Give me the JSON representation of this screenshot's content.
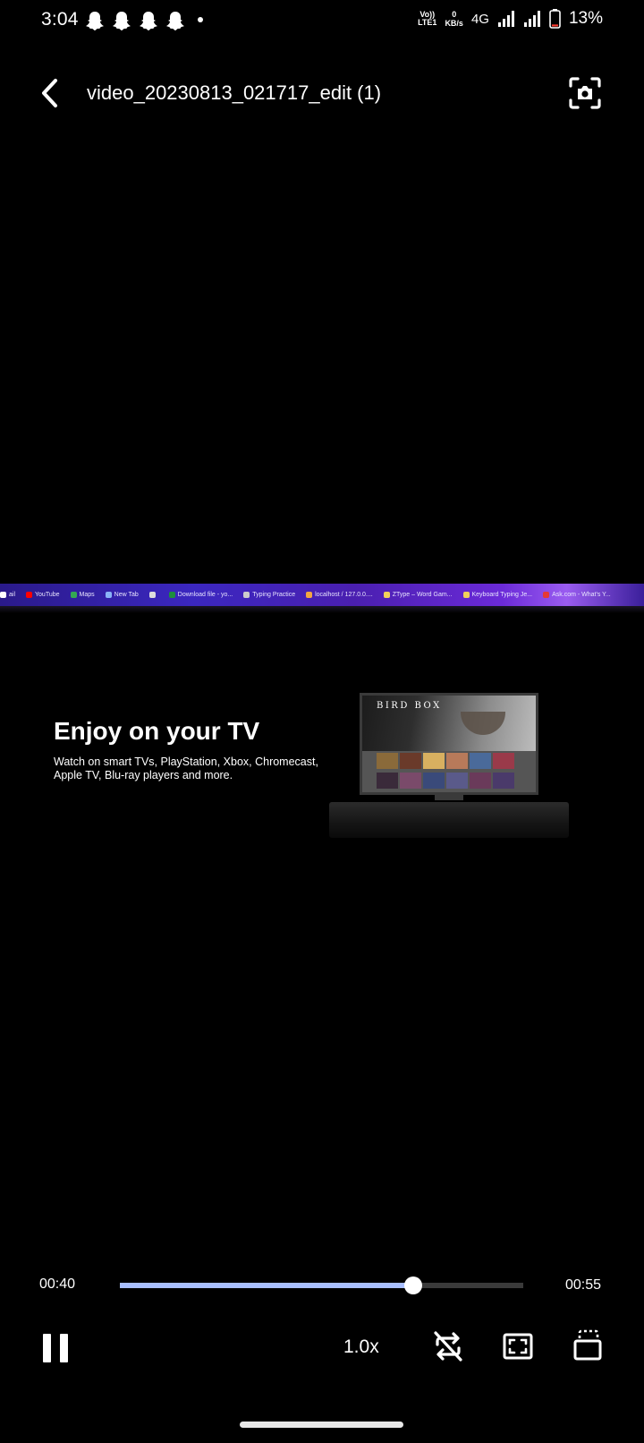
{
  "status_bar": {
    "time": "3:04",
    "notification_icons": [
      "snapchat-icon",
      "snapchat-icon",
      "snapchat-icon",
      "snapchat-icon"
    ],
    "volte_top": "Vo))",
    "volte_bottom": "LTE1",
    "net_speed_value": "0",
    "net_speed_unit": "KB/s",
    "network_type": "4G",
    "battery_percent": "13%",
    "battery_level": 0.13
  },
  "header": {
    "title": "video_20230813_021717_edit (1)"
  },
  "video": {
    "bookmarks": [
      {
        "label": "ail",
        "color": "#ffffff"
      },
      {
        "label": "YouTube",
        "color": "#ff0000"
      },
      {
        "label": "Maps",
        "color": "#34a853"
      },
      {
        "label": "New Tab",
        "color": "#8ab4f8"
      },
      {
        "label": "",
        "color": "#dddddd"
      },
      {
        "label": "Download file - yo...",
        "color": "#1e8e3e"
      },
      {
        "label": "Typing Practice",
        "color": "#cccccc"
      },
      {
        "label": "localhost / 127.0.0....",
        "color": "#f4a742"
      },
      {
        "label": "ZType – Word Gam...",
        "color": "#f2d15b"
      },
      {
        "label": "Keyboard Typing Je...",
        "color": "#f2d15b"
      },
      {
        "label": "Ask.com - What's Y...",
        "color": "#e53935"
      }
    ],
    "heading": "Enjoy on your TV",
    "description": "Watch on smart TVs, PlayStation, Xbox, Chromecast, Apple TV, Blu-ray players and more.",
    "tv_show_title": "BIRD BOX"
  },
  "playback": {
    "current_time": "00:40",
    "total_time": "00:55",
    "progress": 0.727,
    "speed": "1.0x",
    "accent_color": "#a9bfff"
  }
}
